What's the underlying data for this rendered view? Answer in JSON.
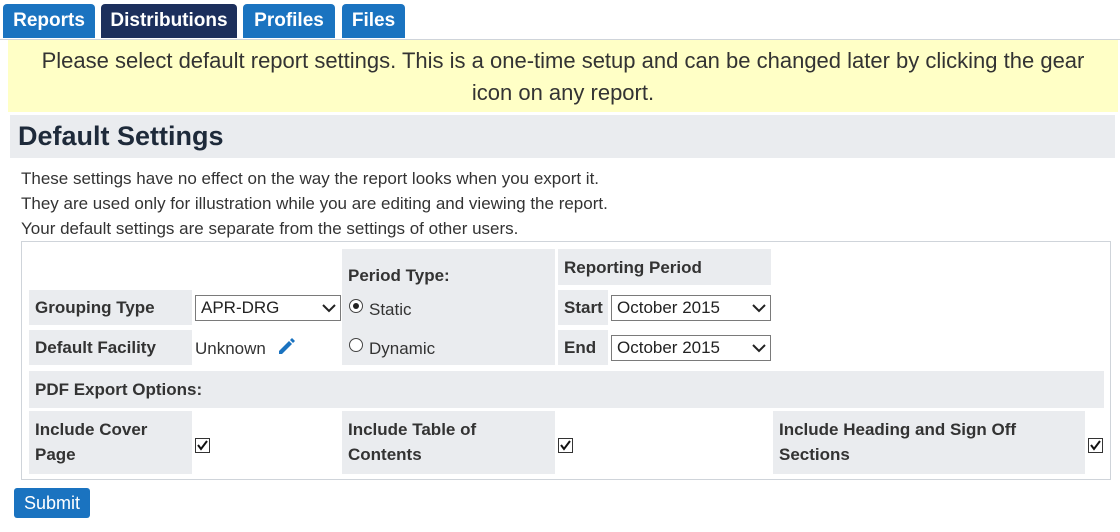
{
  "tabs": [
    {
      "label": "Reports",
      "active": false
    },
    {
      "label": "Distributions",
      "active": true
    },
    {
      "label": "Profiles",
      "active": false
    },
    {
      "label": "Files",
      "active": false
    }
  ],
  "notice": {
    "line1": "Please select default report settings. This is a one-time setup and can be changed later by clicking the gear",
    "line2": "icon on any report."
  },
  "heading": "Default Settings",
  "description": [
    "These settings have no effect on the way the report looks when you export it.",
    "They are used only for illustration while you are editing and viewing the report.",
    "Your default settings are separate from the settings of other users."
  ],
  "form": {
    "grouping_type_label": "Grouping Type",
    "grouping_type_value": "APR-DRG",
    "default_facility_label": "Default Facility",
    "default_facility_value": "Unknown",
    "period_type_label": "Period Type:",
    "period_options": [
      {
        "label": "Static",
        "selected": true
      },
      {
        "label": "Dynamic",
        "selected": false
      }
    ],
    "reporting_period_label": "Reporting Period",
    "start_label": "Start",
    "start_value": "October 2015",
    "end_label": "End",
    "end_value": "October 2015",
    "pdf_export_label": "PDF Export Options:",
    "include_cover_line1": "Include Cover",
    "include_cover_line2": "Page",
    "include_cover_checked": true,
    "include_toc_line1": "Include Table of",
    "include_toc_line2": "Contents",
    "include_toc_checked": true,
    "include_heading_line1": "Include Heading and Sign Off",
    "include_heading_line2": "Sections",
    "include_heading_checked": true
  },
  "submit_label": "Submit",
  "colors": {
    "tab": "#1a73c0",
    "tab_active": "#1c2f5c",
    "notice_bg": "#ffffc6",
    "panel_cell_bg": "#eaecef",
    "edit_icon": "#1a73c0"
  },
  "icons": {
    "edit": "pencil-icon",
    "dropdown": "chevron-down-icon",
    "checkbox": "checkmark-icon"
  }
}
